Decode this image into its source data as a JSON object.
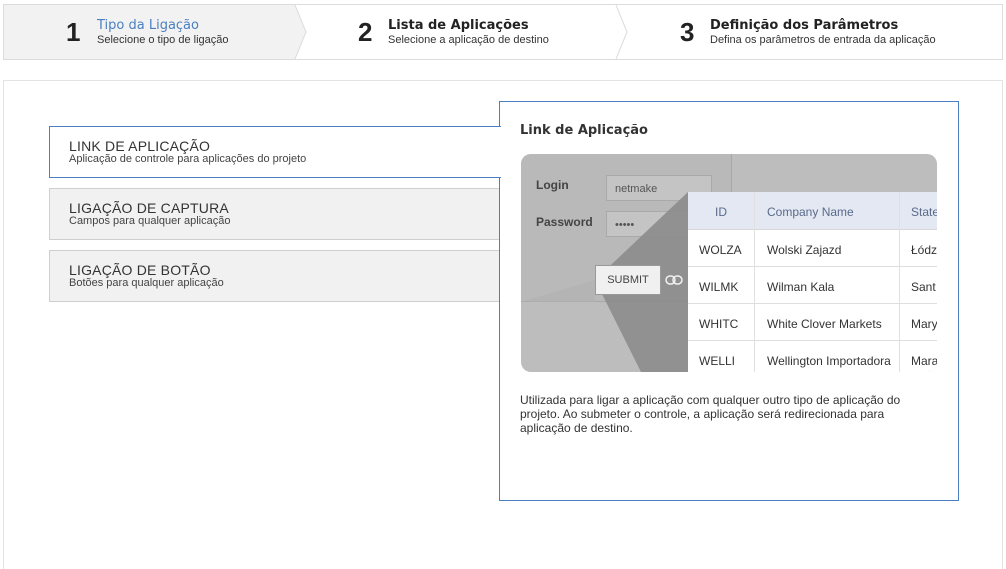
{
  "steps": [
    {
      "num": "1",
      "title": "Tipo da Ligação",
      "subtitle": "Selecione o tipo de ligação",
      "active": true
    },
    {
      "num": "2",
      "title": "Lista de Aplicações",
      "subtitle": "Selecione a aplicação de destino",
      "active": false
    },
    {
      "num": "3",
      "title": "Definição dos Parâmetros",
      "subtitle": "Defina os parâmetros de entrada da aplicação",
      "active": false
    }
  ],
  "options": [
    {
      "title": "LINK DE APLICAÇÃO",
      "subtitle": "Aplicação de controle para aplicações do projeto",
      "selected": true
    },
    {
      "title": "LIGAÇÃO DE CAPTURA",
      "subtitle": "Campos para qualquer aplicação",
      "selected": false
    },
    {
      "title": "LIGAÇÃO DE BOTÃO",
      "subtitle": "Botões para qualquer aplicação",
      "selected": false
    }
  ],
  "preview": {
    "title": "Link de Aplicação",
    "description": "Utilizada para ligar a aplicação com qualquer outro tipo de aplicação do projeto. Ao submeter o controle, a aplicação será redirecionada para aplicação de destino.",
    "illustration": {
      "login_label": "Login",
      "login_value": "netmake",
      "password_label": "Password",
      "password_value": "•••••",
      "submit_label": "SUBMIT",
      "columns": [
        "ID",
        "Company Name",
        "State"
      ],
      "rows": [
        [
          "WOLZA",
          "Wolski Zajazd",
          "Łódz"
        ],
        [
          "WILMK",
          "Wilman Kala",
          "Sant"
        ],
        [
          "WHITC",
          "White Clover Markets",
          "Mary"
        ],
        [
          "WELLI",
          "Wellington Importadora",
          "Mara"
        ]
      ]
    }
  },
  "colors": {
    "accent": "#4a7fc1",
    "step_active_bg": "#f2f2f2",
    "option_bg": "#f1f1f1"
  }
}
